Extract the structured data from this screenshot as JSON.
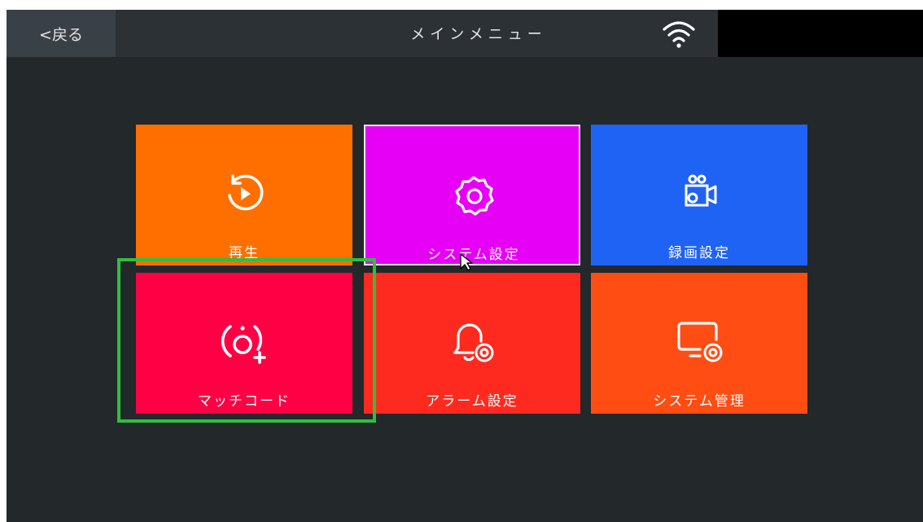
{
  "header": {
    "back_label": "<戻る",
    "title": "メインメニュー",
    "wifi_icon": "wifi-icon"
  },
  "tiles": [
    {
      "label": "再生",
      "icon": "playback-icon",
      "color": "#ff6f00"
    },
    {
      "label": "システム設定",
      "icon": "settings-gear-icon",
      "color": "#e600f5"
    },
    {
      "label": "録画設定",
      "icon": "record-camera-icon",
      "color": "#1f63f5"
    },
    {
      "label": "マッチコード",
      "icon": "match-code-icon",
      "color": "#ff0044"
    },
    {
      "label": "アラーム設定",
      "icon": "alarm-bell-icon",
      "color": "#ff2a1f"
    },
    {
      "label": "システム管理",
      "icon": "system-manage-icon",
      "color": "#ff4d14"
    }
  ],
  "colors": {
    "background": "#23282b",
    "topbar": "#2b3135",
    "highlight": "#2fbf3f"
  }
}
